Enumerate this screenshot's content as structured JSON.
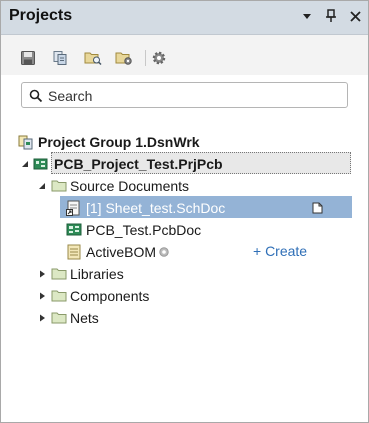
{
  "panel": {
    "title": "Projects"
  },
  "search": {
    "placeholder": "Search"
  },
  "tree": {
    "group_label": "Project Group 1.DsnWrk",
    "project_label": "PCB_Project_Test.PrjPcb",
    "source_docs_label": "Source Documents",
    "sheet_label": "[1] Sheet_test.SchDoc",
    "pcb_label": "PCB_Test.PcbDoc",
    "bom_label": "ActiveBOM",
    "create_label": "+ Create",
    "libraries_label": "Libraries",
    "components_label": "Components",
    "nets_label": "Nets"
  },
  "icons": {
    "dropdown": "dropdown-arrow-icon",
    "pin": "pin-icon",
    "close": "close-icon",
    "save": "save-icon",
    "copy": "copy-icon",
    "open_folder": "folder-search-icon",
    "folder_settings": "folder-settings-icon",
    "settings": "gear-icon",
    "search": "search-icon"
  },
  "colors": {
    "titlebar": "#d3dbe3",
    "selection": "#94b3d6",
    "link": "#2f6fb7"
  }
}
